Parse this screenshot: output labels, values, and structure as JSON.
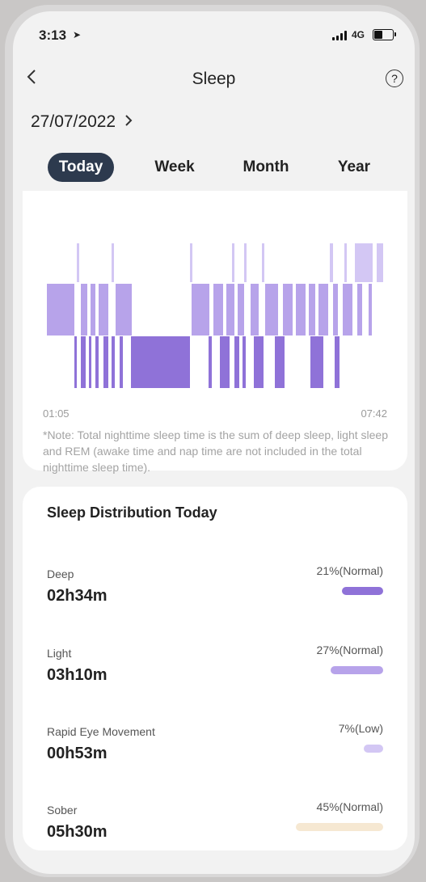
{
  "status_bar": {
    "time": "3:13",
    "location_icon": "location-arrow-icon",
    "network": "4G",
    "battery_icon": "battery-icon"
  },
  "header": {
    "back_icon": "chevron-left-icon",
    "title": "Sleep",
    "help_icon": "question-circle-icon"
  },
  "date": {
    "label": "27/07/2022",
    "chevron_icon": "chevron-right-icon"
  },
  "tabs": [
    {
      "label": "Today",
      "active": true
    },
    {
      "label": "Week",
      "active": false
    },
    {
      "label": "Month",
      "active": false
    },
    {
      "label": "Year",
      "active": false
    }
  ],
  "chart_data": {
    "type": "timeline",
    "start_label": "01:05",
    "end_label": "07:42",
    "stages": [
      "Deep",
      "Light",
      "Rapid Eye Movement"
    ],
    "colors": {
      "Deep": "#8f72d8",
      "Light": "#b7a3ea",
      "Rapid Eye Movement": "#d3c7f4"
    }
  },
  "note": "*Note: Total nighttime sleep time is the sum of deep sleep, light sleep and REM (awake time and nap time are not included in the total nighttime sleep time).",
  "distribution": {
    "title": "Sleep Distribution Today",
    "items": [
      {
        "label": "Deep",
        "value": "02h34m",
        "percent": "21%(Normal)",
        "color": "#8f72d8",
        "share": 0.21
      },
      {
        "label": "Light",
        "value": "03h10m",
        "percent": "27%(Normal)",
        "color": "#b7a3ea",
        "share": 0.27
      },
      {
        "label": "Rapid Eye Movement",
        "value": "00h53m",
        "percent": "7%(Low)",
        "color": "#d3c7f4",
        "share": 0.07
      },
      {
        "label": "Sober",
        "value": "05h30m",
        "percent": "45%(Normal)",
        "color": "#f6e8d2",
        "share": 0.45
      }
    ]
  }
}
